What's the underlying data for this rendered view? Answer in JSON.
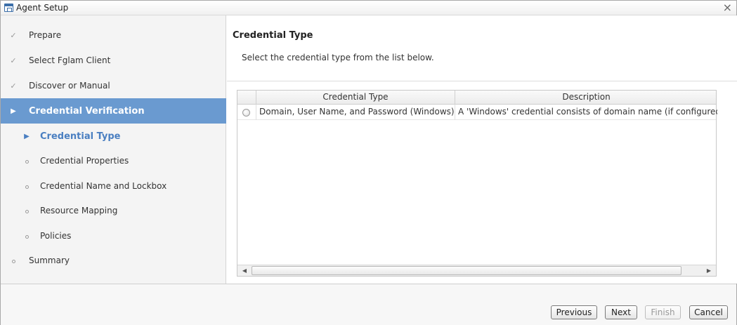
{
  "window": {
    "title": "Agent Setup"
  },
  "sidebar": {
    "steps": [
      {
        "label": "Prepare",
        "status": "done"
      },
      {
        "label": "Select Fglam Client",
        "status": "done"
      },
      {
        "label": "Discover or Manual",
        "status": "done"
      },
      {
        "label": "Credential Verification",
        "status": "active"
      },
      {
        "label": "Credential Type",
        "status": "current"
      },
      {
        "label": "Credential Properties",
        "status": "pending"
      },
      {
        "label": "Credential Name and Lockbox",
        "status": "pending"
      },
      {
        "label": "Resource Mapping",
        "status": "pending"
      },
      {
        "label": "Policies",
        "status": "pending"
      },
      {
        "label": "Summary",
        "status": "pending"
      }
    ],
    "icons": {
      "done": "checkmark-icon",
      "active": "triangle-right-icon",
      "pending": "circle-icon"
    }
  },
  "main": {
    "title": "Credential Type",
    "subtitle": "Select the credential type from the list below.",
    "table": {
      "columns": [
        "Credential Type",
        "Description"
      ],
      "rows": [
        {
          "selected": false,
          "credential_type": "Domain, User Name, and Password (Windows)",
          "description": "A 'Windows' credential consists of domain name (if configured i"
        }
      ]
    }
  },
  "footer": {
    "previous_label": "Previous",
    "next_label": "Next",
    "finish_label": "Finish",
    "finish_enabled": false,
    "cancel_label": "Cancel"
  },
  "colors": {
    "active_step_bg": "#6a9ad0",
    "current_step_text": "#4a7fc1"
  }
}
